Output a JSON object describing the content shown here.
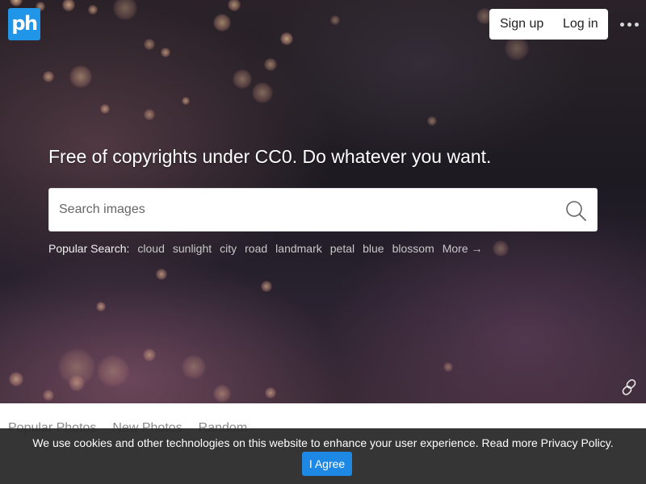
{
  "brand": {
    "logo_text": "ph",
    "logo_color": "#2196e8"
  },
  "header": {
    "signup_label": "Sign up",
    "login_label": "Log in",
    "more_icon": "more-horizontal-icon"
  },
  "hero": {
    "tagline": "Free of copyrights under CC0. Do whatever you want.",
    "search": {
      "placeholder": "Search images",
      "value": "",
      "icon": "search-icon"
    },
    "popular_search": {
      "label": "Popular Search:",
      "tags": [
        "cloud",
        "sunlight",
        "city",
        "road",
        "landmark",
        "petal",
        "blue",
        "blossom"
      ],
      "more_label": "More →"
    },
    "link_icon": "link-icon"
  },
  "tabs": [
    "Popular Photos",
    "New Photos",
    "Random"
  ],
  "cookie": {
    "message": "We use cookies and other technologies on this website to enhance your user experience. Read more Privacy Policy.",
    "agree_label": "I Agree",
    "button_color": "#1e88e5"
  }
}
